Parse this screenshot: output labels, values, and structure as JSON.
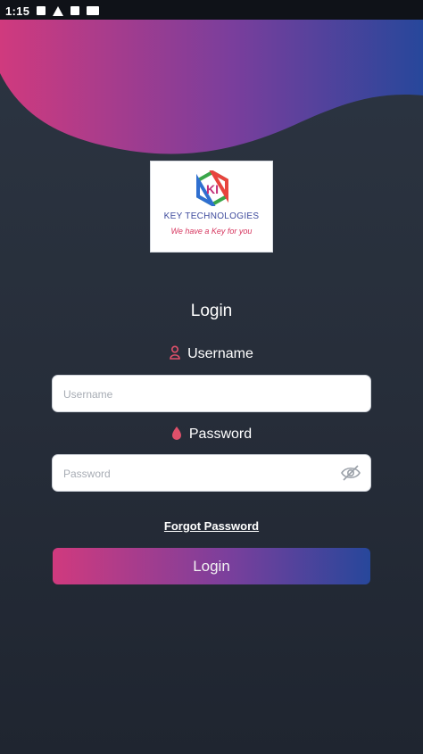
{
  "status_bar": {
    "time": "1:15",
    "icons": [
      "image-icon",
      "warning-icon",
      "app-icon",
      "sim-icon"
    ]
  },
  "logo": {
    "mark": "KI",
    "company": "KEY TECHNOLOGIES",
    "tagline": "We have a Key for you"
  },
  "form": {
    "title": "Login",
    "username": {
      "label": "Username",
      "icon": "user-icon",
      "placeholder": "Username"
    },
    "password": {
      "label": "Password",
      "icon": "lock-icon",
      "placeholder": "Password",
      "toggle_icon": "eye-off-icon"
    },
    "forgot_label": "Forgot Password",
    "submit_label": "Login"
  },
  "colors": {
    "gradient_start": "#d03a7e",
    "gradient_end": "#27479b",
    "background": "#262d39",
    "icon_accent": "#e0506a"
  }
}
